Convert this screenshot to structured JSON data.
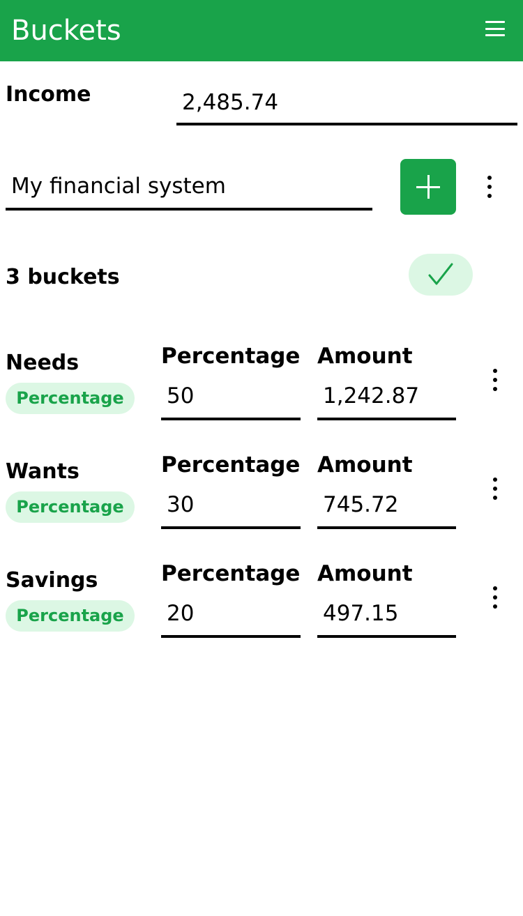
{
  "appbar": {
    "title": "Buckets",
    "menu_icon": "hamburger-menu-icon"
  },
  "income": {
    "label": "Income",
    "value": "2,485.74"
  },
  "system": {
    "name": "My financial system",
    "add_icon": "plus-icon",
    "more_icon": "more-vertical-icon"
  },
  "summary": {
    "count_label": "3 buckets",
    "confirm_icon": "checkmark-icon"
  },
  "buckets": [
    {
      "name": "Needs",
      "type_chip": "Percentage",
      "percentage_header": "Percentage",
      "percentage": "50",
      "amount_header": "Amount",
      "amount": "1,242.87"
    },
    {
      "name": "Wants",
      "type_chip": "Percentage",
      "percentage_header": "Percentage",
      "percentage": "30",
      "amount_header": "Amount",
      "amount": "745.72"
    },
    {
      "name": "Savings",
      "type_chip": "Percentage",
      "percentage_header": "Percentage",
      "percentage": "20",
      "amount_header": "Amount",
      "amount": "497.15"
    }
  ],
  "colors": {
    "primary": "#19a34a",
    "chip_background": "#dcf7e4",
    "text": "#000000"
  }
}
